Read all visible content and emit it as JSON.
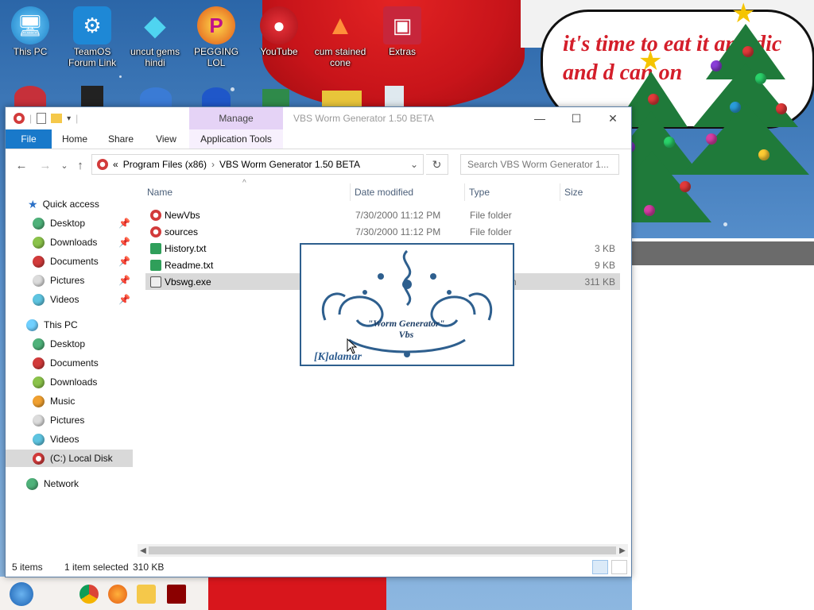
{
  "desktop": {
    "speech_text": "it's time to eat it and dic and d can on",
    "icons": [
      {
        "label": "This PC",
        "icon": "monitor-icon"
      },
      {
        "label": "TeamOS Forum Link",
        "icon": "gear-icon"
      },
      {
        "label": "uncut gems hindi",
        "icon": "gem-icon"
      },
      {
        "label": "PEGGING LOL",
        "icon": "pinball-icon"
      },
      {
        "label": "YouTube",
        "icon": "angry-bird-icon"
      },
      {
        "label": "cum stained cone",
        "icon": "cone-icon"
      },
      {
        "label": "Extras",
        "icon": "box-icon"
      }
    ]
  },
  "window": {
    "title": "VBS Worm Generator 1.50 BETA",
    "manage_tab": "Manage",
    "minimize": "—",
    "maximize": "☐",
    "close": "✕"
  },
  "ribbon": {
    "tabs": [
      "File",
      "Home",
      "Share",
      "View",
      "Application Tools"
    ]
  },
  "navigation": {
    "back": "←",
    "forward": "→",
    "recent": "⌄",
    "up": "↑",
    "address_prefix": "«",
    "breadcrumb": [
      "Program Files (x86)",
      "VBS Worm Generator 1.50 BETA"
    ],
    "separator": "›",
    "dropdown": "⌄",
    "refresh": "↻",
    "search_placeholder": "Search VBS Worm Generator 1..."
  },
  "sidebar": {
    "quick_access": "Quick access",
    "quick_items": [
      "Desktop",
      "Downloads",
      "Documents",
      "Pictures",
      "Videos"
    ],
    "this_pc": "This PC",
    "pc_items": [
      "Desktop",
      "Documents",
      "Downloads",
      "Music",
      "Pictures",
      "Videos",
      "(C:) Local Disk"
    ],
    "network": "Network",
    "pin": "📌"
  },
  "files": {
    "columns": [
      "Name",
      "Date modified",
      "Type",
      "Size"
    ],
    "rows": [
      {
        "name": "NewVbs",
        "date": "7/30/2000 11:12 PM",
        "type": "File folder",
        "size": ""
      },
      {
        "name": "sources",
        "date": "7/30/2000 11:12 PM",
        "type": "File folder",
        "size": ""
      },
      {
        "name": "History.txt",
        "date": "",
        "type": "",
        "size": "3 KB"
      },
      {
        "name": "Readme.txt",
        "date": "",
        "type": "",
        "size": "9 KB"
      },
      {
        "name": "Vbswg.exe",
        "date": "",
        "type": "n",
        "size": "311 KB"
      }
    ]
  },
  "splash": {
    "title": "\"Worm Generator\" Vbs",
    "author": "[K]alamar"
  },
  "status": {
    "items": "5 items",
    "selected": "1 item selected",
    "size": "310 KB"
  },
  "colors": {
    "accent": "#1979ca",
    "manage": "#e5d3f6",
    "selection": "#d9d9d9"
  }
}
